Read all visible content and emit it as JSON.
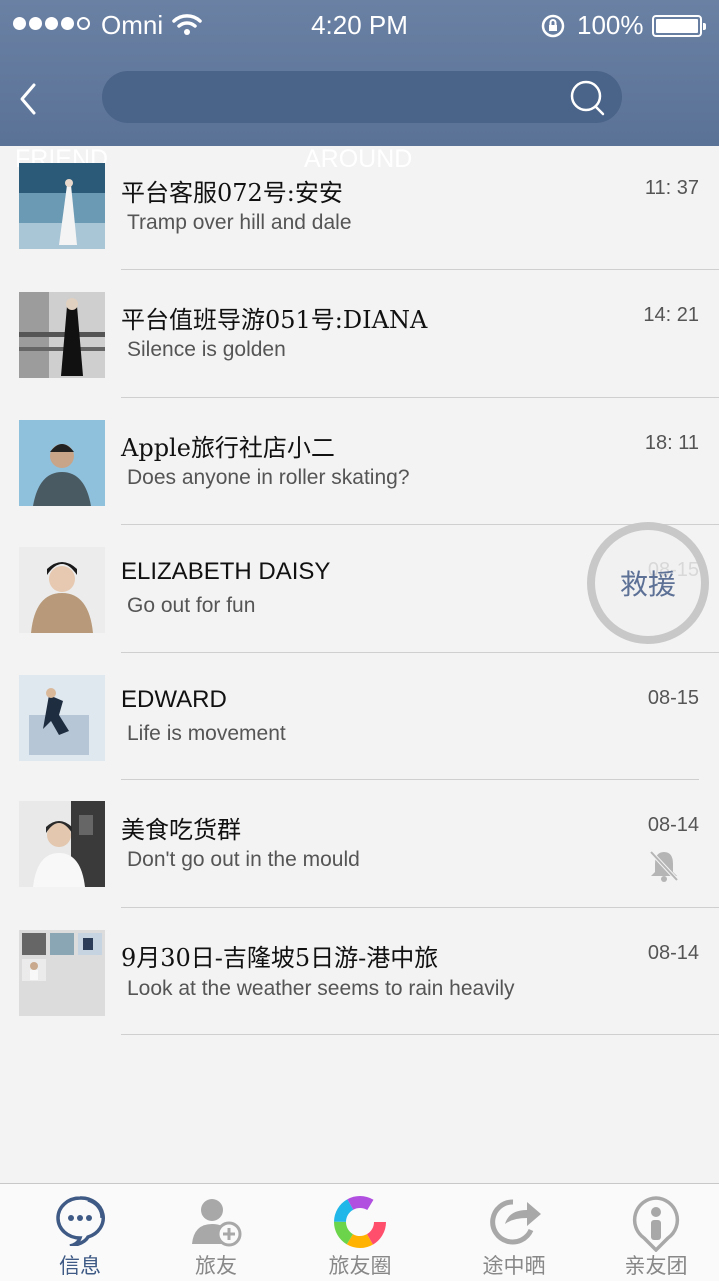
{
  "status_bar": {
    "carrier": "Omni",
    "time": "4:20 PM",
    "battery": "100%"
  },
  "search": {
    "placeholder": ""
  },
  "ghost_tabs": {
    "left": "FRIEND",
    "right": "AROUND"
  },
  "chats": [
    {
      "name": "平台客服072号:安安",
      "message": "Tramp over hill and dale",
      "time": "11: 37",
      "muted": false
    },
    {
      "name": "平台值班导游051号:DIANA",
      "message": "Silence is golden",
      "time": "14: 21",
      "muted": false
    },
    {
      "name": "Apple旅行社店小二",
      "message": "Does anyone in roller skating?",
      "time": "18: 11",
      "muted": false
    },
    {
      "name": "ELIZABETH  DAISY",
      "message": "Go out for fun",
      "time": "08-15",
      "muted": false
    },
    {
      "name": "EDWARD",
      "message": "Life is movement",
      "time": "08-15",
      "muted": false
    },
    {
      "name": "美食吃货群",
      "message": "Don't go out in the mould",
      "time": "08-14",
      "muted": true
    },
    {
      "name": "9月30日-吉隆坡5日游-港中旅",
      "message": "Look at the weather seems to rain heavily",
      "time": "08-14",
      "muted": false
    }
  ],
  "rescue_button": {
    "label": "救援"
  },
  "tabs": [
    {
      "label": "信息",
      "icon": "message-bubble-icon",
      "active": true
    },
    {
      "label": "旅友",
      "icon": "add-friend-icon",
      "active": false
    },
    {
      "label": "旅友圈",
      "icon": "color-ring-icon",
      "active": false
    },
    {
      "label": "途中晒",
      "icon": "share-arrow-icon",
      "active": false
    },
    {
      "label": "亲友团",
      "icon": "location-person-icon",
      "active": false
    }
  ],
  "colors": {
    "header": "#5f7799",
    "accent": "#3e5a85",
    "background": "#f3f3f3"
  }
}
